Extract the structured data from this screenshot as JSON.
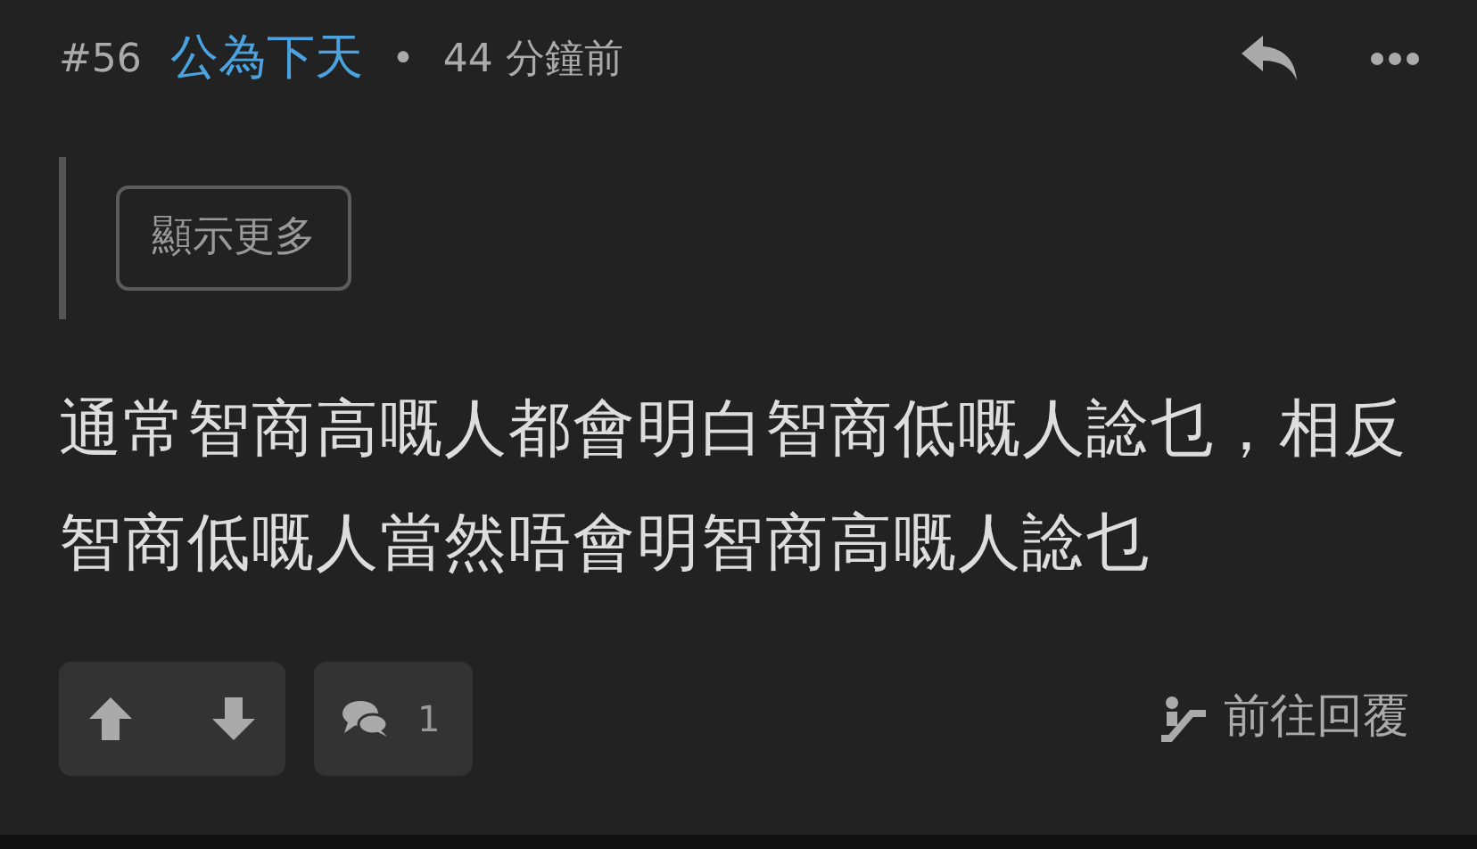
{
  "post": {
    "number": "#56",
    "author": "公為下天",
    "separator": "•",
    "time": "44 分鐘前"
  },
  "quote": {
    "show_more": "顯示更多"
  },
  "body": "通常智商高嘅人都會明白智商低嘅人諗乜，相反智商低嘅人當然唔會明智商高嘅人諗乜",
  "footer": {
    "comment_count": "1",
    "goto_reply": "前往回覆"
  }
}
